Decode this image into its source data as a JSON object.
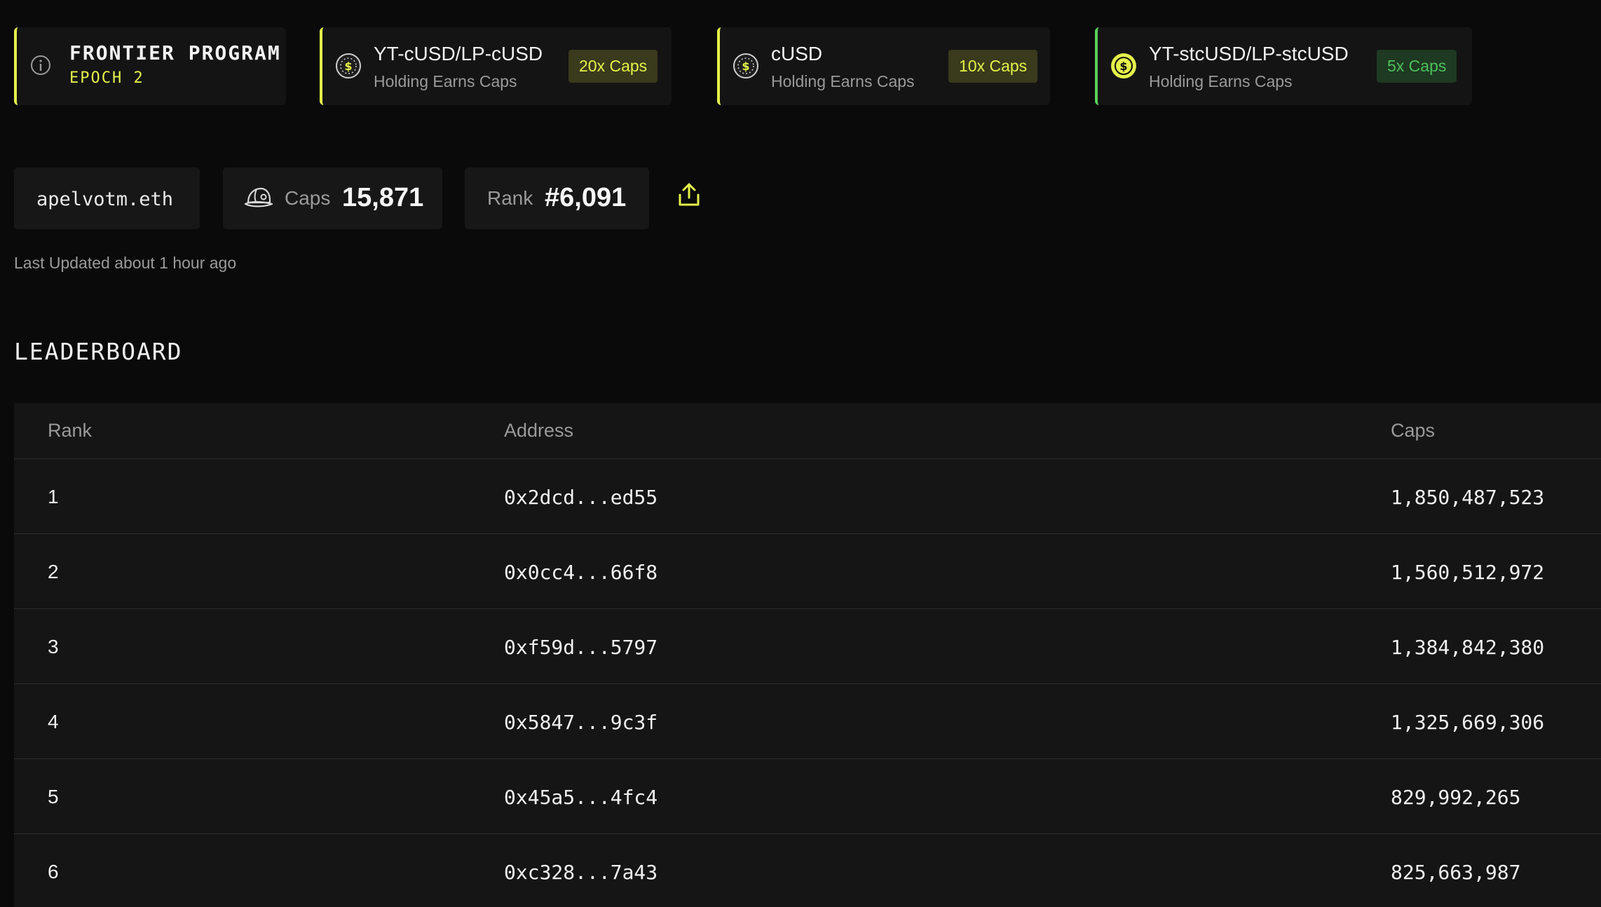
{
  "program": {
    "title": "FRONTIER PROGRAM",
    "epoch": "EPOCH 2"
  },
  "token_cards": [
    {
      "name": "YT-cUSD/LP-cUSD",
      "subtitle": "Holding Earns Caps",
      "badge": "20x Caps",
      "accent": "#e4f24a"
    },
    {
      "name": "cUSD",
      "subtitle": "Holding Earns Caps",
      "badge": "10x Caps",
      "accent": "#e4f24a"
    },
    {
      "name": "YT-stcUSD/LP-stcUSD",
      "subtitle": "Holding Earns Caps",
      "badge": "5x Caps",
      "accent": "#5ad15a"
    }
  ],
  "user": {
    "ens": "apelvotm.eth",
    "caps_label": "Caps",
    "caps_value": "15,871",
    "rank_label": "Rank",
    "rank_value": "#6,091",
    "last_updated": "Last Updated about 1 hour ago"
  },
  "leaderboard": {
    "title": "LEADERBOARD",
    "columns": [
      "Rank",
      "Address",
      "Caps"
    ],
    "rows": [
      {
        "rank": "1",
        "address": "0x2dcd...ed55",
        "caps": "1,850,487,523"
      },
      {
        "rank": "2",
        "address": "0x0cc4...66f8",
        "caps": "1,560,512,972"
      },
      {
        "rank": "3",
        "address": "0xf59d...5797",
        "caps": "1,384,842,380"
      },
      {
        "rank": "4",
        "address": "0x5847...9c3f",
        "caps": "1,325,669,306"
      },
      {
        "rank": "5",
        "address": "0x45a5...4fc4",
        "caps": "829,992,265"
      },
      {
        "rank": "6",
        "address": "0xc328...7a43",
        "caps": "825,663,987"
      }
    ]
  },
  "colors": {
    "accent_yellow": "#e4f24a",
    "accent_green": "#5ad15a",
    "background": "#0a0a0a",
    "card": "#141414"
  },
  "icons": {
    "info": "info-circle-icon",
    "coin": "dollar-coin-icon",
    "cap": "cap-icon",
    "share": "share-icon"
  }
}
